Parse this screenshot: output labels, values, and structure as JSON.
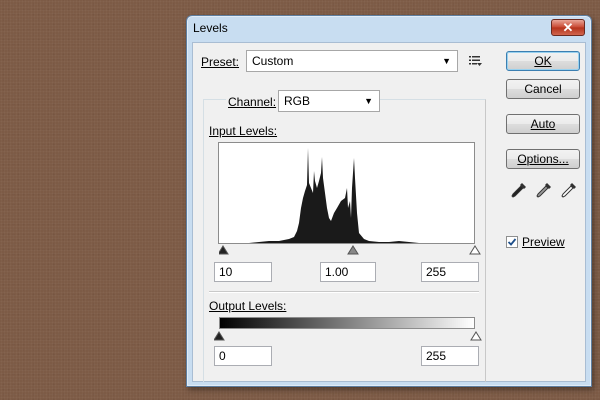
{
  "dialog": {
    "title": "Levels",
    "close_label": "✕"
  },
  "preset": {
    "label": "Preset:",
    "value": "Custom"
  },
  "channel": {
    "label": "Channel:",
    "value": "RGB"
  },
  "input_levels": {
    "label": "Input Levels:",
    "black": "10",
    "gamma": "1.00",
    "white": "255"
  },
  "output_levels": {
    "label": "Output Levels:",
    "black": "0",
    "white": "255"
  },
  "buttons": {
    "ok": "OK",
    "cancel": "Cancel",
    "auto": "Auto",
    "options": "Options..."
  },
  "preview": {
    "label": "Preview",
    "checked": true
  },
  "icons": {
    "preset_menu": "preset-options-icon",
    "eyedroppers": [
      "black-eyedropper-icon",
      "gray-eyedropper-icon",
      "white-eyedropper-icon"
    ]
  },
  "colors": {
    "desktop": "#7d5b46",
    "title_bar": "#c8ddf1",
    "close_button": "#c8462f",
    "histogram_fill": "#1a1a1a"
  }
}
